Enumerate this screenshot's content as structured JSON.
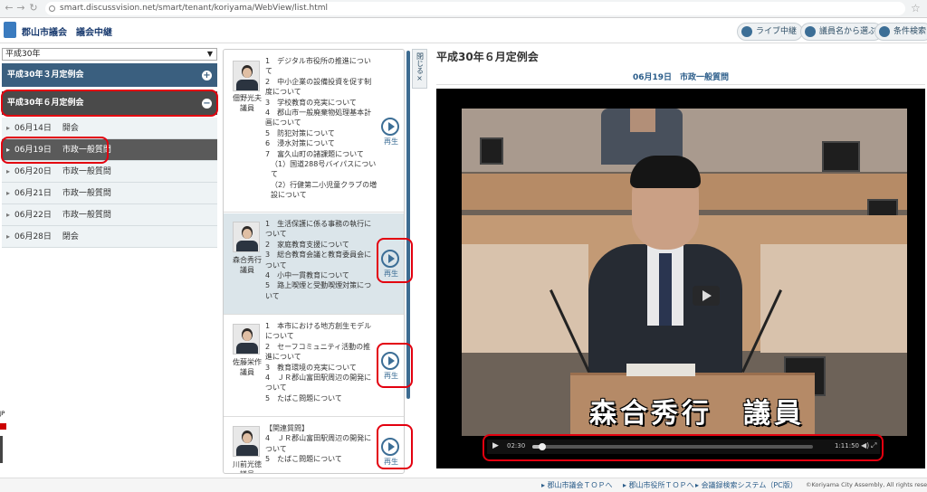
{
  "browser": {
    "url": "smart.discussvision.net/smart/tenant/koriyama/WebView/list.html"
  },
  "header": {
    "logo_text": "郡山市議会　議会中継",
    "buttons": [
      {
        "label": "ライブ中継",
        "icon": "broadcast-icon"
      },
      {
        "label": "議員名から選ぶ",
        "icon": "person-icon"
      },
      {
        "label": "条件検索",
        "icon": "search-icon"
      }
    ]
  },
  "sidebar": {
    "year_select": "平成30年",
    "sessions": [
      {
        "label": "平成30年３月定例会",
        "toggle": "+"
      },
      {
        "label": "平成30年６月定例会",
        "toggle": "−"
      }
    ],
    "days": [
      {
        "date": "06月14日",
        "label": "開会"
      },
      {
        "date": "06月19日",
        "label": "市政一般質問"
      },
      {
        "date": "06月20日",
        "label": "市政一般質問"
      },
      {
        "date": "06月21日",
        "label": "市政一般質問"
      },
      {
        "date": "06月22日",
        "label": "市政一般質問"
      },
      {
        "date": "06月28日",
        "label": "閉会"
      }
    ]
  },
  "speakers": [
    {
      "name": "佃野光夫",
      "title": "議員",
      "topics": [
        "1　デジタル市役所の推進について",
        "2　中小企業の設備投資を促す制度について",
        "3　学校教育の充実について",
        "4　郡山市一般廃棄物処理基本計画について",
        "5　防犯対策について",
        "6　浸水対策について",
        "7　富久山町の諸課題について",
        "（1）国道288号バイパスについて",
        "（2）行健第二小児童クラブの増設について"
      ],
      "play_label": "再生"
    },
    {
      "name": "森合秀行",
      "title": "議員",
      "topics": [
        "1　生活保護に係る事務の執行について",
        "2　家庭教育支援について",
        "3　総合教育会議と教育委員会について",
        "4　小中一貫教育について",
        "5　路上喫煙と受動喫煙対策について"
      ],
      "play_label": "再生"
    },
    {
      "name": "佐藤栄作",
      "title": "議員",
      "topics": [
        "1　本市における地方創生モデルについて",
        "2　セーフコミュニティ活動の推進について",
        "3　教育環境の充実について",
        "4　ＪＲ郡山富田駅周辺の開発について",
        "5　たばこ問題について"
      ],
      "play_label": "再生"
    },
    {
      "name": "川前光徳",
      "title": "議員",
      "topics": [
        "【関連質問】",
        "4　ＪＲ郡山富田駅周辺の開発について",
        "5　たばこ問題について"
      ],
      "play_label": "再生"
    }
  ],
  "close_tab": {
    "label": "閉じる",
    "icon": "×"
  },
  "video": {
    "title": "平成30年６月定例会",
    "subtitle": "06月19日　市政一般質問",
    "caption": "森合秀行　議員",
    "current_time": "02:30",
    "duration": "1:11:50",
    "progress": 0.035
  },
  "footer": {
    "links": [
      "郡山市議会ＴＯＰへ",
      "郡山市役所ＴＯＰへ",
      "会議録検索システム（PC版）"
    ],
    "copyright": "©Koriyama City Assembly, All rights reserved."
  },
  "colors": {
    "session_header": "#3a5f7f",
    "session_active": "#4a4a4a",
    "accent": "#3c6e96",
    "annotation": "#e3000f"
  }
}
